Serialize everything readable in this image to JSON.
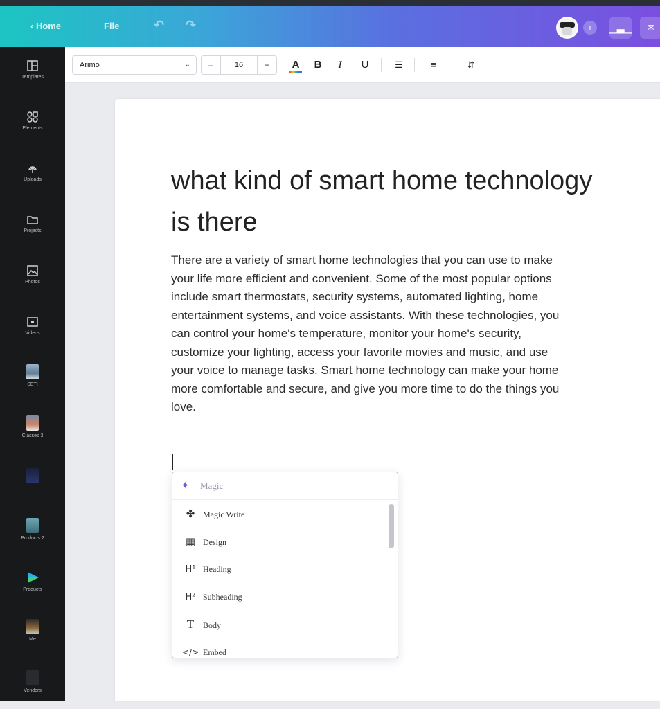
{
  "topbar": {
    "back_label": "Home",
    "file_label": "File",
    "undo_icon": "undo-icon",
    "redo_icon": "redo-icon",
    "add_glyph": "+"
  },
  "sidebar": {
    "items": [
      {
        "label": "Templates",
        "icon": "templates-icon"
      },
      {
        "label": "Elements",
        "icon": "elements-icon"
      },
      {
        "label": "Uploads",
        "icon": "uploads-icon"
      },
      {
        "label": "Projects",
        "icon": "projects-icon"
      },
      {
        "label": "Photos",
        "icon": "photos-icon"
      },
      {
        "label": "Videos",
        "icon": "videos-icon"
      },
      {
        "label": "SETI",
        "icon": "folder-thumb"
      },
      {
        "label": "Classes 3",
        "icon": "folder-thumb"
      },
      {
        "label": "",
        "icon": "folder-thumb"
      },
      {
        "label": "Products 2",
        "icon": "folder-thumb"
      },
      {
        "label": "Products",
        "icon": "play-thumb"
      },
      {
        "label": "Me",
        "icon": "folder-thumb"
      },
      {
        "label": "Vendors",
        "icon": "folder-thumb"
      }
    ]
  },
  "toolbar": {
    "font_family": "Arimo",
    "font_size": "16",
    "minus": "–",
    "plus": "+",
    "text_color_glyph": "A",
    "bold_glyph": "B",
    "italic_glyph": "I",
    "underline_glyph": "U"
  },
  "document": {
    "heading_line1": "what kind of smart home technology",
    "heading_line2": "is there",
    "body_lines": [
      "There are a variety of smart home technologies that you can use to make",
      "your life more efficient and convenient. Some of the most popular options",
      "include smart thermostats, security systems, automated lighting, home",
      "entertainment systems, and voice assistants. With these technologies, you",
      "can control your home's temperature, monitor your home's security,",
      "customize your lighting, access your favorite movies and music, and use",
      "your voice to manage tasks. Smart home technology can make your home",
      "more comfortable and secure, and give you more time to do the things you",
      "love."
    ]
  },
  "magic_menu": {
    "search_placeholder": "Magic",
    "items": [
      {
        "label": "Magic Write",
        "icon": "magic-wand-icon"
      },
      {
        "label": "Design",
        "icon": "design-grid-icon"
      },
      {
        "label": "Heading",
        "icon": "heading-h1-icon"
      },
      {
        "label": "Subheading",
        "icon": "heading-h2-icon"
      },
      {
        "label": "Body",
        "icon": "text-t-icon"
      },
      {
        "label": "Embed",
        "icon": "embed-code-icon"
      }
    ]
  }
}
